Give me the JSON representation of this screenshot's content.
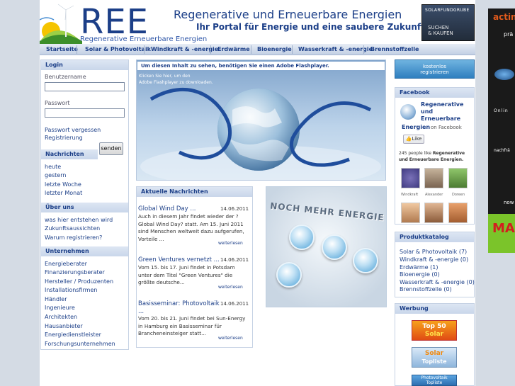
{
  "header": {
    "logo_text": "REE",
    "logo_sub": "Regenerative Erneuerbare Energien",
    "title": "Regenerative und Erneuerbare Energien",
    "subtitle": "Ihr Portal für Energie und eine saubere Zukunft",
    "promo_line1": "SOLARFUNDGRUBE",
    "promo_line2": "SUCHEN",
    "promo_line3": "& KAUFEN"
  },
  "nav": [
    "Startseite",
    "Solar & Photovoltaik",
    "Windkraft & -energie",
    "Erdwärme",
    "Bioenergie",
    "Wasserkraft & -energie",
    "Brennstoffzelle"
  ],
  "login": {
    "heading": "Login",
    "username_label": "Benutzername",
    "password_label": "Passwort",
    "forgot": "Passwort vergessen",
    "register": "Registrierung",
    "submit": "senden"
  },
  "news_nav": {
    "heading": "Nachrichten",
    "items": [
      "heute",
      "gestern",
      "letzte Woche",
      "letzter Monat"
    ]
  },
  "about": {
    "heading": "Über uns",
    "items": [
      "was hier entstehen wird",
      "Zukunftsaussichten",
      "Warum registrieren?"
    ]
  },
  "companies": {
    "heading": "Unternehmen",
    "items": [
      "Energieberater",
      "Finanzierungsberater",
      "Hersteller / Produzenten",
      "Installationsfirmen",
      "Händler",
      "Ingenieure",
      "Architekten",
      "Hausanbieter",
      "Energiedienstleister",
      "Forschungsunternehmen"
    ]
  },
  "flash": {
    "notice": "Um diesen Inhalt zu sehen, benötigen Sie einen Adobe Flashplayer.",
    "hint_line1": "Klicken Sie hier, um den",
    "hint_line2": "Adobe Flashplayer zu downloaden."
  },
  "latest_news": {
    "heading": "Aktuelle Nachrichten",
    "more_label": "weiterlesen",
    "items": [
      {
        "title": "Global Wind Day ...",
        "date": "14.06.2011",
        "lines": [
          "Auch in diesem Jahr findet wieder der ?",
          "Global Wind Day? statt. Am 15. Juni 2011",
          "sind Menschen weltweit dazu aufgerufen,",
          "Vorteile ..."
        ]
      },
      {
        "title": "Green Ventures vernetzt ...",
        "date": "14.06.2011",
        "lines": [
          "Vom 15. bis 17. Juni findet in Potsdam",
          "unter dem Titel \"Green Ventures\" die",
          "größte deutsche..."
        ]
      },
      {
        "title": "Basisseminar: Photovoltaik",
        "title2": "...",
        "date": "14.06.2011",
        "lines": [
          "Vom 20. bis 21. Juni findet bei Sun-Energy",
          "in Hamburg ein Basisseminar für",
          "Brancheneinsteiger statt..."
        ]
      }
    ]
  },
  "energy_banner": {
    "text": "NOCH MEHR ENERGIE"
  },
  "register_button": {
    "line1": "kostenlos",
    "line2": "registrieren"
  },
  "facebook": {
    "heading": "Facebook",
    "page_line1": "Regenerative",
    "page_line2": "und",
    "page_line3": "Erneuerbare",
    "page_line4": "Energien",
    "on_facebook": "on Facebook",
    "like": "Like",
    "fans_prefix": "245 people like",
    "fans_page": "Regenerative und",
    "fans_page2": "Erneuerbare Energien.",
    "fans": [
      "Windkraft",
      "Alexander",
      "Doreen"
    ]
  },
  "catalog": {
    "heading": "Produktkatalog",
    "items": [
      "Solar & Photovoltaik (7)",
      "Windkraft & -energie (0)",
      "Erdwärme (1)",
      "Bioenergie (0)",
      "Wasserkraft & -energie (0)",
      "Brennstoffzelle (0)"
    ]
  },
  "ads": {
    "heading": "Werbung",
    "banner1_top": "Top 50",
    "banner1_bottom": "Solar",
    "banner2_top": "Solar",
    "banner2_bottom": "Topliste",
    "banner3_top": "Photovoltaik",
    "banner3_bottom": "Topliste"
  },
  "side_banner": {
    "line1": "acting",
    "line2": "prä",
    "line3": "Onlin",
    "line4": "nachfrä",
    "line5": "now",
    "line6": "MA"
  },
  "colors": {
    "brand_blue": "#1c3f88",
    "nav_bg": "#c9d6ea",
    "box_border": "#c6d2e4"
  }
}
